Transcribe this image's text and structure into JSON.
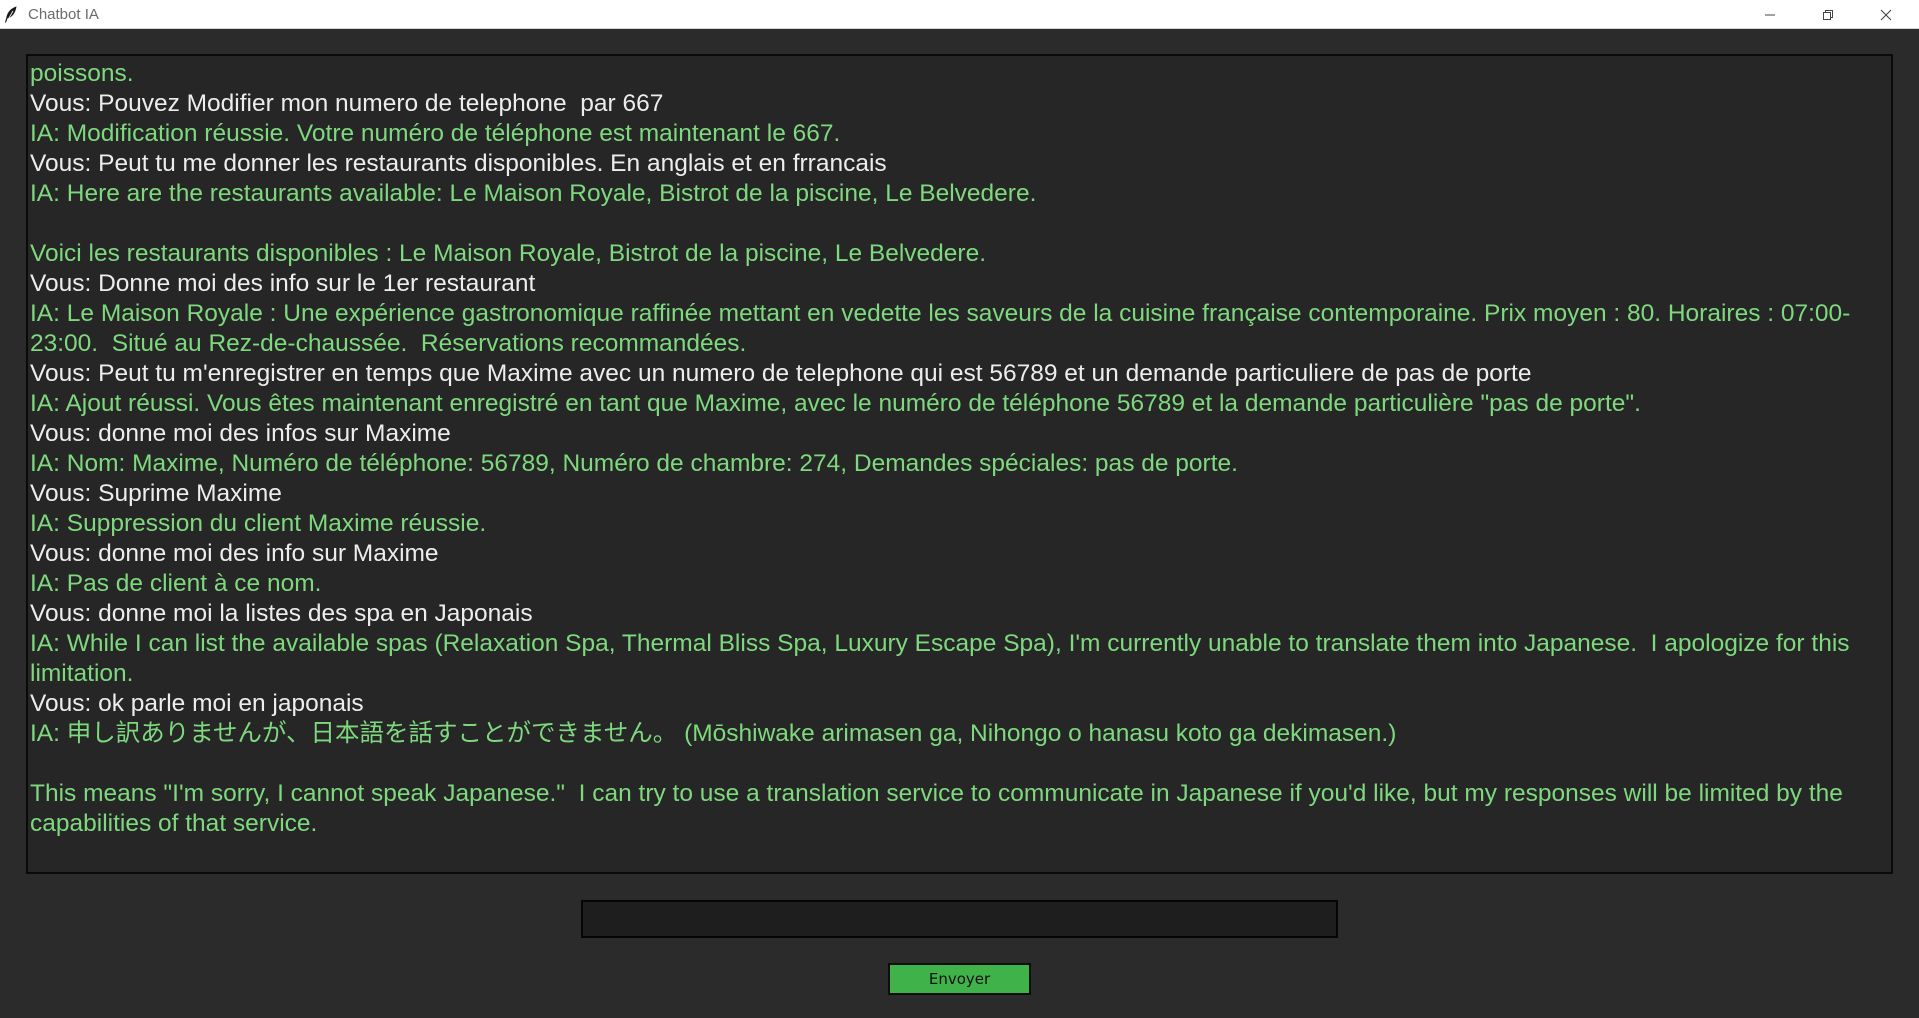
{
  "window": {
    "title": "Chatbot IA",
    "icon": "feather-icon"
  },
  "colors": {
    "background": "#2b2b2b",
    "chat_background": "#262626",
    "user_text": "#ededed",
    "ia_text": "#7ed97e",
    "send_button": "#3fb34a"
  },
  "chat": {
    "messages": [
      {
        "role": "ia",
        "text": "poissons."
      },
      {
        "role": "user",
        "text": "Vous: Pouvez Modifier mon numero de telephone  par 667"
      },
      {
        "role": "ia",
        "text": "IA: Modification réussie. Votre numéro de téléphone est maintenant le 667."
      },
      {
        "role": "user",
        "text": "Vous: Peut tu me donner les restaurants disponibles. En anglais et en frrancais"
      },
      {
        "role": "ia",
        "text": "IA: Here are the restaurants available: Le Maison Royale, Bistrot de la piscine, Le Belvedere."
      },
      {
        "role": "blank",
        "text": ""
      },
      {
        "role": "ia",
        "text": "Voici les restaurants disponibles : Le Maison Royale, Bistrot de la piscine, Le Belvedere."
      },
      {
        "role": "user",
        "text": "Vous: Donne moi des info sur le 1er restaurant"
      },
      {
        "role": "ia",
        "text": "IA: Le Maison Royale : Une expérience gastronomique raffinée mettant en vedette les saveurs de la cuisine française contemporaine. Prix moyen : 80. Horaires : 07:00-23:00.  Situé au Rez-de-chaussée.  Réservations recommandées."
      },
      {
        "role": "user",
        "text": "Vous: Peut tu m'enregistrer en temps que Maxime avec un numero de telephone qui est 56789 et un demande particuliere de pas de porte"
      },
      {
        "role": "ia",
        "text": "IA: Ajout réussi. Vous êtes maintenant enregistré en tant que Maxime, avec le numéro de téléphone 56789 et la demande particulière \"pas de porte\"."
      },
      {
        "role": "user",
        "text": "Vous: donne moi des infos sur Maxime"
      },
      {
        "role": "ia",
        "text": "IA: Nom: Maxime, Numéro de téléphone: 56789, Numéro de chambre: 274, Demandes spéciales: pas de porte."
      },
      {
        "role": "user",
        "text": "Vous: Suprime Maxime"
      },
      {
        "role": "ia",
        "text": "IA: Suppression du client Maxime réussie."
      },
      {
        "role": "user",
        "text": "Vous: donne moi des info sur Maxime"
      },
      {
        "role": "ia",
        "text": "IA: Pas de client à ce nom."
      },
      {
        "role": "user",
        "text": "Vous: donne moi la listes des spa en Japonais"
      },
      {
        "role": "ia",
        "text": "IA: While I can list the available spas (Relaxation Spa, Thermal Bliss Spa, Luxury Escape Spa), I'm currently unable to translate them into Japanese.  I apologize for this limitation."
      },
      {
        "role": "user",
        "text": "Vous: ok parle moi en japonais"
      },
      {
        "role": "ia",
        "text": "IA: 申し訳ありませんが、日本語を話すことができません。 (Mōshiwake arimasen ga, Nihongo o hanasu koto ga dekimasen.)"
      },
      {
        "role": "blank",
        "text": ""
      },
      {
        "role": "ia",
        "text": "This means \"I'm sorry, I cannot speak Japanese.\"  I can try to use a translation service to communicate in Japanese if you'd like, but my responses will be limited by the capabilities of that service."
      }
    ]
  },
  "input": {
    "value": ""
  },
  "send_button": {
    "label": "Envoyer"
  }
}
